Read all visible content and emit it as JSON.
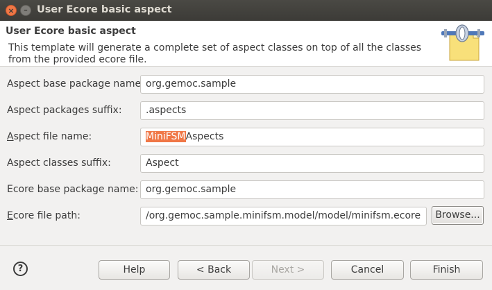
{
  "window": {
    "title": "User Ecore basic aspect",
    "close_glyph": "×",
    "minimize_glyph": "–"
  },
  "header": {
    "title": "User Ecore basic aspect",
    "description": "This template will generate a complete set of aspect classes on top of all the classes from the provided ecore file.",
    "icon": "wizard-banner-icon"
  },
  "form": {
    "base_package": {
      "label": "Aspect base package name:",
      "value": "org.gemoc.sample"
    },
    "packages_suffix": {
      "label": "Aspect packages suffix:",
      "value": ".aspects"
    },
    "file_name": {
      "label_mnemonic": "A",
      "label_rest": "spect file name:",
      "value_selected": "MiniFSM",
      "value_rest": "Aspects"
    },
    "classes_suffix": {
      "label": "Aspect classes suffix:",
      "value": "Aspect"
    },
    "ecore_package": {
      "label": "Ecore base package name:",
      "value": "org.gemoc.sample"
    },
    "ecore_path": {
      "label_mnemonic": "E",
      "label_rest": "core file path:",
      "value": "/org.gemoc.sample.minifsm.model/model/minifsm.ecore",
      "browse_label": "Browse..."
    }
  },
  "footer": {
    "help_glyph": "?",
    "help_label": "Help",
    "back_label": "< Back",
    "next_label": "Next >",
    "cancel_label": "Cancel",
    "finish_label": "Finish"
  },
  "colors": {
    "selection": "#f07746",
    "titlebar": "#3c3b37",
    "close_button": "#f07746"
  }
}
